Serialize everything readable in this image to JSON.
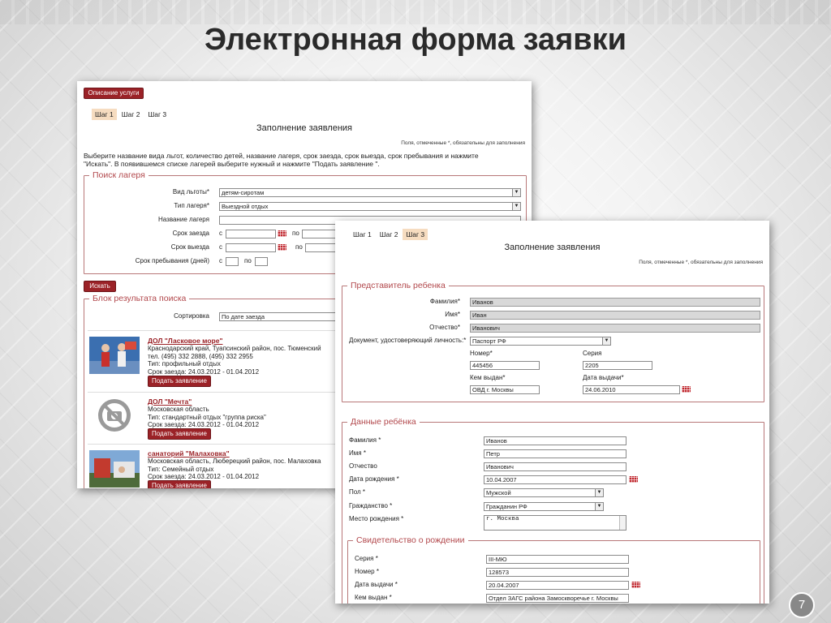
{
  "slide": {
    "title": "Электронная форма заявки",
    "page_number": "7"
  },
  "form1": {
    "service_button": "Описание услуги",
    "steps": [
      "Шаг 1",
      "Шаг 2",
      "Шаг 3"
    ],
    "title": "Заполнение заявления",
    "required_note": "Поля, отмеченные *, обязательны для заполнения",
    "instruction": "Выберите название вида льгот, количество детей, название лагеря, срок заезда, срок выезда, срок пребывания и нажмите \"Искать\". В появившемся списке лагерей выберите нужный и нажмите \"Подать заявление \".",
    "search_legend": "Поиск лагеря",
    "benefit_label": "Вид льготы",
    "benefit_value": "детям-сиротам",
    "camp_type_label": "Тип лагеря",
    "camp_type_value": "Выездной отдых",
    "camp_name_label": "Название лагеря",
    "arrival_label": "Срок заезда",
    "departure_label": "Срок выезда",
    "stay_label": "Срок пребывания (дней)",
    "from": "с",
    "to": "по",
    "search_button": "Искать",
    "results_legend": "Блок результата поиска",
    "sort_label": "Сортировка",
    "sort_value": "По дате заезда",
    "apply_button": "Подать заявление",
    "camps": [
      {
        "name": "ДОЛ \"Ласковое море\"",
        "details": "Краснодарский край, Туапсинский район, пос. Тюменский\nтел. (495) 332 2888, (495) 332 2955\nТип: профильный отдых\nСрок заезда: 24.03.2012 - 01.04.2012"
      },
      {
        "name": "ДОЛ \"Мечта\"",
        "details": "Московская область\nТип: стандартный отдых \"группа риска\"\nСрок заезда: 24.03.2012 - 01.04.2012"
      },
      {
        "name": "санаторий \"Малаховка\"",
        "details": "Московская область, Люберецкий район, пос. Малаховка\nТип: Семейный отдых\nСрок заезда: 24.03.2012 - 01.04.2012"
      }
    ]
  },
  "form2": {
    "steps": [
      "Шаг 1",
      "Шаг 2",
      "Шаг 3"
    ],
    "title": "Заполнение заявления",
    "required_note": "Поля, отмеченные *, обязательны для заполнения",
    "rep_legend": "Представитель ребенка",
    "rep_surname_label": "Фамилия",
    "rep_surname": "Иванов",
    "rep_name_label": "Имя",
    "rep_name": "Иван",
    "rep_patronymic_label": "Отчество",
    "rep_patronymic": "Иванович",
    "doc_label": "Документ, удостоверяющий личность:",
    "doc_value": "Паспорт РФ",
    "number_label": "Номер",
    "number_value": "445456",
    "series_label": "Серия",
    "series_value": "2205",
    "issued_by_label": "Кем выдан",
    "issued_by_value": "ОВД г. Москвы",
    "issue_date_label": "Дата выдачи",
    "issue_date_value": "24.06.2010",
    "child_legend": "Данные ребёнка",
    "child_surname_label": "Фамилия",
    "child_surname": "Иванов",
    "child_name_label": "Имя",
    "child_name": "Петр",
    "child_patronymic_label": "Отчество",
    "child_patronymic": "Иванович",
    "birth_date_label": "Дата рождения",
    "birth_date": "10.04.2007",
    "sex_label": "Пол",
    "sex_value": "Мужской",
    "citizenship_label": "Гражданство",
    "citizenship_value": "Гражданин РФ",
    "birthplace_label": "Место рождения",
    "birthplace_value": "г. Москва",
    "cert_legend": "Свидетельство о рождении",
    "cert_series_label": "Серия",
    "cert_series": "III-МЮ",
    "cert_number_label": "Номер",
    "cert_number": "128573",
    "cert_date_label": "Дата выдачи",
    "cert_date": "20.04.2007",
    "cert_issued_label": "Кем выдан",
    "cert_issued": "Отдел ЗАГС района Замоскворечье г. Москвы"
  },
  "colors": {
    "accent_red": "#9b2227",
    "legend_red": "#b2484c",
    "active_step": "#f6dcc0"
  }
}
